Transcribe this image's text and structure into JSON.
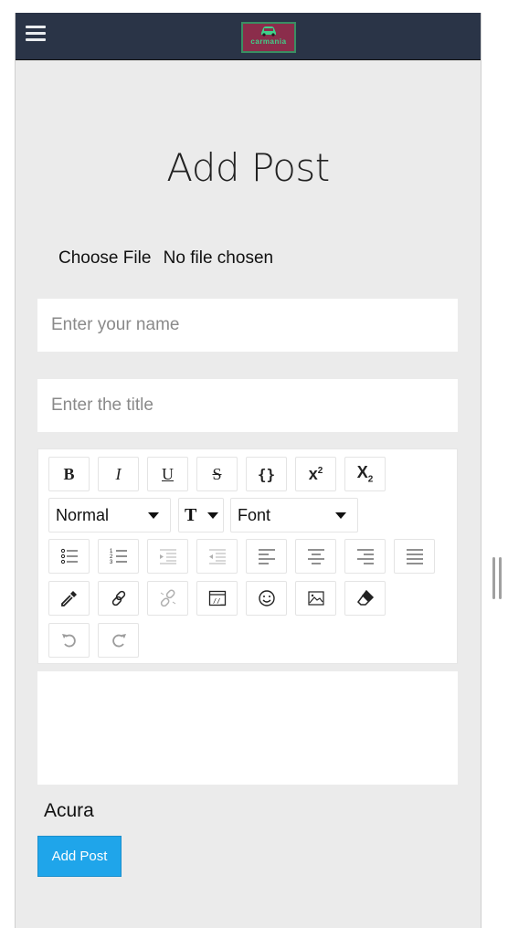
{
  "navbar": {
    "menu_icon": "hamburger-menu-icon",
    "logo_text": "carmania",
    "logo_colors": {
      "background": "#8b2d4b",
      "border": "#3a8f63",
      "text": "#3fd18a"
    },
    "background": "#2a3447"
  },
  "page": {
    "title": "Add Post",
    "background": "#ebebeb"
  },
  "form": {
    "file_button": "Choose File",
    "file_status": "No file chosen",
    "name_placeholder": "Enter your name",
    "name_value": "",
    "title_placeholder": "Enter the title",
    "title_value": "",
    "brand_label": "Acura",
    "submit_label": "Add Post",
    "submit_color": "#1fa5ea"
  },
  "editor_toolbar": {
    "row1": [
      {
        "name": "bold",
        "icon": "bold-icon"
      },
      {
        "name": "italic",
        "icon": "italic-icon"
      },
      {
        "name": "underline",
        "icon": "underline-icon"
      },
      {
        "name": "strikethrough",
        "icon": "strikethrough-icon"
      },
      {
        "name": "code",
        "icon": "code-braces-icon"
      },
      {
        "name": "superscript",
        "icon": "superscript-icon"
      },
      {
        "name": "subscript",
        "icon": "subscript-icon"
      }
    ],
    "block_type": "Normal",
    "font_family": "Font",
    "font_size_icon": "font-size-icon",
    "row3": [
      {
        "name": "unordered-list",
        "icon": "bullet-list-icon",
        "enabled": true
      },
      {
        "name": "ordered-list",
        "icon": "numbered-list-icon",
        "enabled": true
      },
      {
        "name": "indent",
        "icon": "indent-icon",
        "enabled": false
      },
      {
        "name": "outdent",
        "icon": "outdent-icon",
        "enabled": false
      },
      {
        "name": "align-left",
        "icon": "align-left-icon",
        "enabled": true
      },
      {
        "name": "align-center",
        "icon": "align-center-icon",
        "enabled": true
      },
      {
        "name": "align-right",
        "icon": "align-right-icon",
        "enabled": true
      },
      {
        "name": "align-justify",
        "icon": "align-justify-icon",
        "enabled": true
      }
    ],
    "row4": [
      {
        "name": "color-picker",
        "icon": "eyedropper-icon",
        "enabled": true
      },
      {
        "name": "link",
        "icon": "link-icon",
        "enabled": true
      },
      {
        "name": "unlink",
        "icon": "unlink-icon",
        "enabled": false
      },
      {
        "name": "embedded",
        "icon": "embed-icon",
        "enabled": true
      },
      {
        "name": "emoji",
        "icon": "smiley-icon",
        "enabled": true
      },
      {
        "name": "image",
        "icon": "image-icon",
        "enabled": true
      },
      {
        "name": "remove-style",
        "icon": "eraser-icon",
        "enabled": true
      }
    ],
    "row5": [
      {
        "name": "undo",
        "icon": "undo-icon",
        "enabled": false
      },
      {
        "name": "redo",
        "icon": "redo-icon",
        "enabled": false
      }
    ]
  },
  "editor": {
    "content": ""
  }
}
